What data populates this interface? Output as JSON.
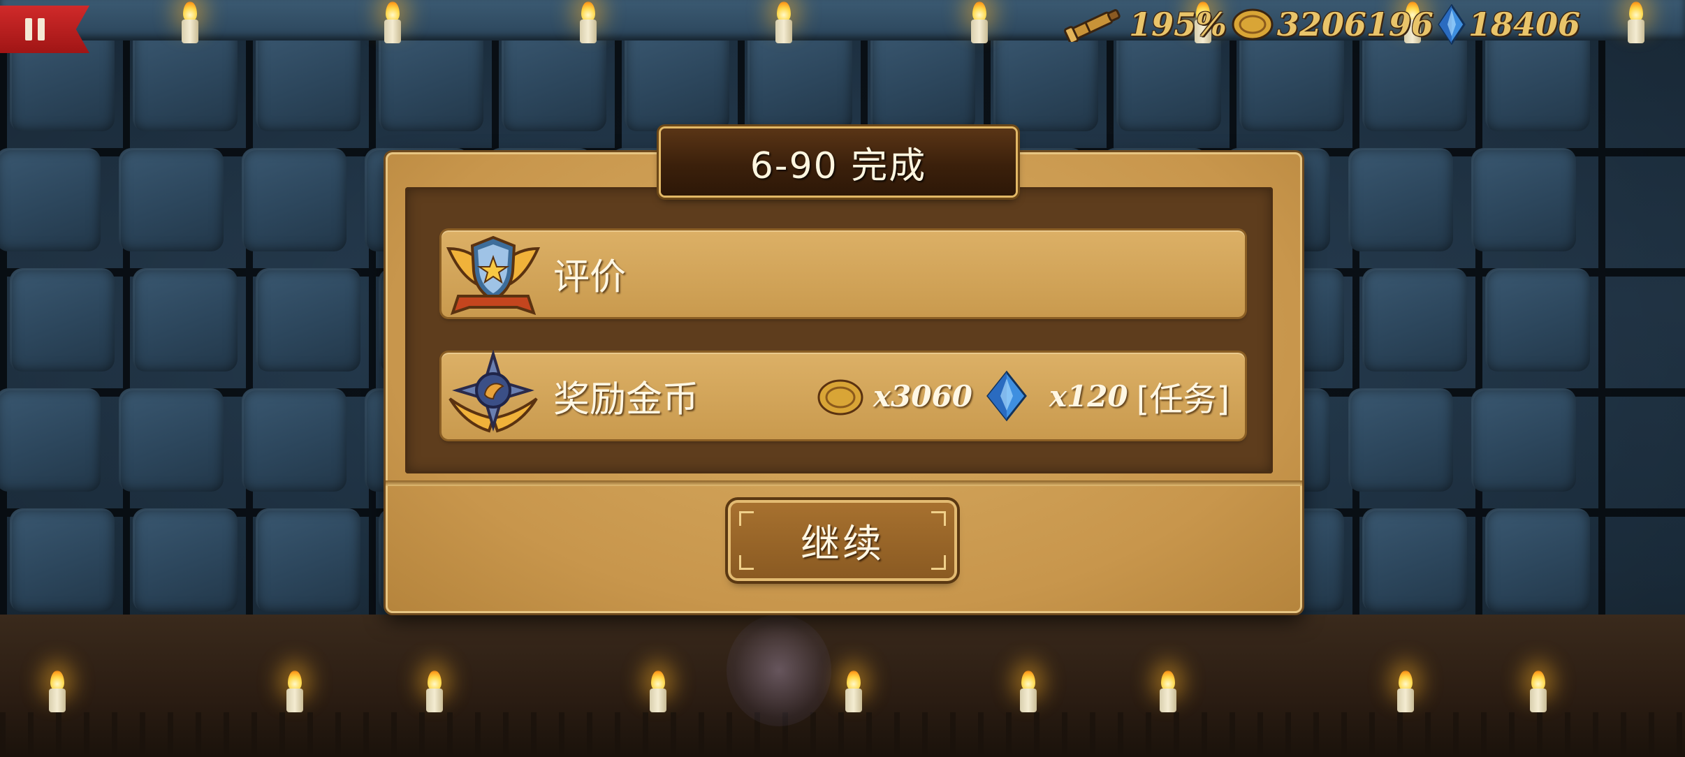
{
  "hud": {
    "pause_icon": "pause-icon",
    "scope_percent": "195%",
    "gold": "3206196",
    "gems": "18406"
  },
  "dialog": {
    "title": "6-90 完成",
    "rating_label": "评价",
    "reward_label": "奖励金币",
    "coin_reward": "x3060",
    "gem_reward": "x120",
    "task_tag": "[任务]",
    "continue_label": "继续"
  },
  "colors": {
    "panel_gold": "#c8964c",
    "panel_dark": "#5e3d1d",
    "hud_text": "#e9c46a",
    "pause_red": "#c02020"
  }
}
